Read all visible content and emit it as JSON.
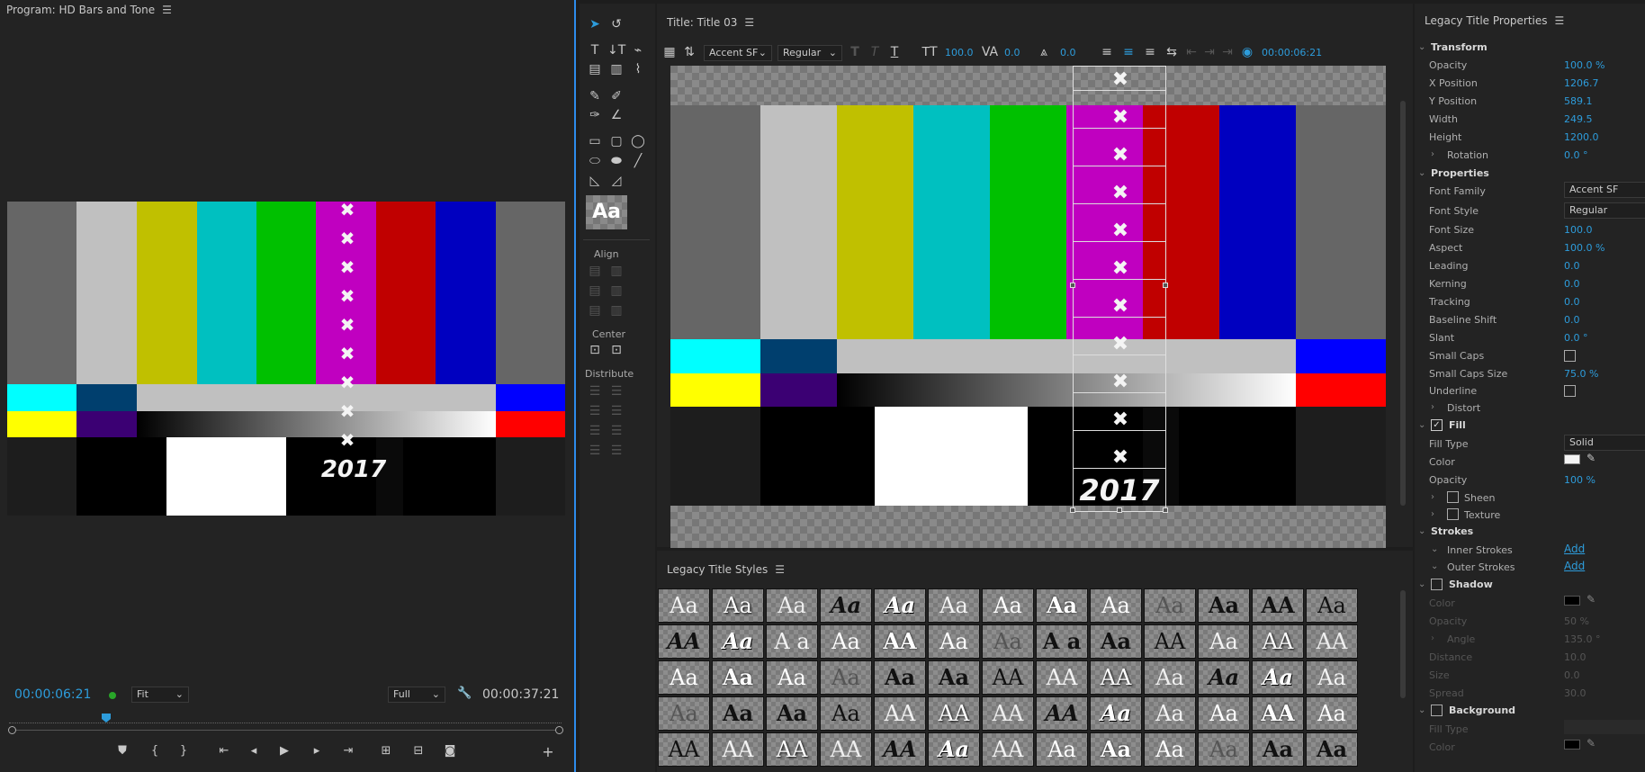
{
  "program": {
    "title": "Program: HD Bars and Tone",
    "timecode_current": "00:00:06:21",
    "fit_label": "Fit",
    "quality_label": "Full",
    "timecode_duration": "00:00:37:21"
  },
  "bars_label": "2017",
  "title_panel": {
    "title": "Title: Title 03",
    "font_family": "Accent SF",
    "font_style": "Regular",
    "size": "100.0",
    "kerning": "0.0",
    "leading": "0.0",
    "timecode": "00:00:06:21",
    "align_label": "Align",
    "center_label": "Center",
    "distribute_label": "Distribute"
  },
  "styles": {
    "title": "Legacy Title Styles",
    "rows": [
      [
        "Aa",
        "Aa",
        "Aa",
        "Aa",
        "Aa",
        "Aa",
        "Aa",
        "Aa",
        "Aa",
        "Aa",
        "Aa",
        "AA",
        "Aa"
      ],
      [
        "AA",
        "Aa",
        "A a",
        "Aa",
        "AA",
        "Aa",
        "Aa",
        "A a",
        "Aa",
        "AA",
        "Aa",
        "AA",
        "AA"
      ],
      [
        "Aa",
        "Aa",
        "Aa",
        "Aa",
        "Aa",
        "Aa",
        "AA",
        "AA",
        "AA",
        "Aa",
        "Aa",
        "Aa",
        "Aa"
      ],
      [
        "Aa",
        "Aa",
        "Aa",
        "Aa",
        "AA",
        "AA",
        "AA",
        "AA",
        "Aa",
        "Aa",
        "Aa",
        "AA",
        "Aa"
      ],
      [
        "AA",
        "AA",
        "AA",
        "AA",
        "AA",
        "Aa",
        "AA",
        "Aa",
        "Aa",
        "Aa",
        "Aa",
        "Aa",
        "Aa"
      ]
    ]
  },
  "properties": {
    "title": "Legacy Title Properties",
    "transform": {
      "label": "Transform",
      "opacity_label": "Opacity",
      "opacity": "100.0 %",
      "xpos_label": "X Position",
      "xpos": "1206.7",
      "ypos_label": "Y Position",
      "ypos": "589.1",
      "width_label": "Width",
      "width": "249.5",
      "height_label": "Height",
      "height": "1200.0",
      "rotation_label": "Rotation",
      "rotation": "0.0 °"
    },
    "props": {
      "label": "Properties",
      "font_family_label": "Font Family",
      "font_family": "Accent SF",
      "font_style_label": "Font Style",
      "font_style": "Regular",
      "font_size_label": "Font Size",
      "font_size": "100.0",
      "aspect_label": "Aspect",
      "aspect": "100.0 %",
      "leading_label": "Leading",
      "leading": "0.0",
      "kerning_label": "Kerning",
      "kerning": "0.0",
      "tracking_label": "Tracking",
      "tracking": "0.0",
      "baseline_label": "Baseline Shift",
      "baseline": "0.0",
      "slant_label": "Slant",
      "slant": "0.0 °",
      "smallcaps_label": "Small Caps",
      "smallcaps_size_label": "Small Caps Size",
      "smallcaps_size": "75.0 %",
      "underline_label": "Underline",
      "distort_label": "Distort"
    },
    "fill": {
      "label": "Fill",
      "type_label": "Fill Type",
      "type": "Solid",
      "color_label": "Color",
      "opacity_label": "Opacity",
      "opacity": "100 %",
      "sheen_label": "Sheen",
      "texture_label": "Texture"
    },
    "strokes": {
      "label": "Strokes",
      "inner_label": "Inner Strokes",
      "inner_add": "Add",
      "outer_label": "Outer Strokes",
      "outer_add": "Add"
    },
    "shadow": {
      "label": "Shadow",
      "color_label": "Color",
      "opacity_label": "Opacity",
      "opacity": "50 %",
      "angle_label": "Angle",
      "angle": "135.0 °",
      "distance_label": "Distance",
      "distance": "10.0",
      "size_label": "Size",
      "size": "0.0",
      "spread_label": "Spread",
      "spread": "30.0"
    },
    "background": {
      "label": "Background",
      "filltype_label": "Fill Type",
      "color_label": "Color"
    }
  }
}
